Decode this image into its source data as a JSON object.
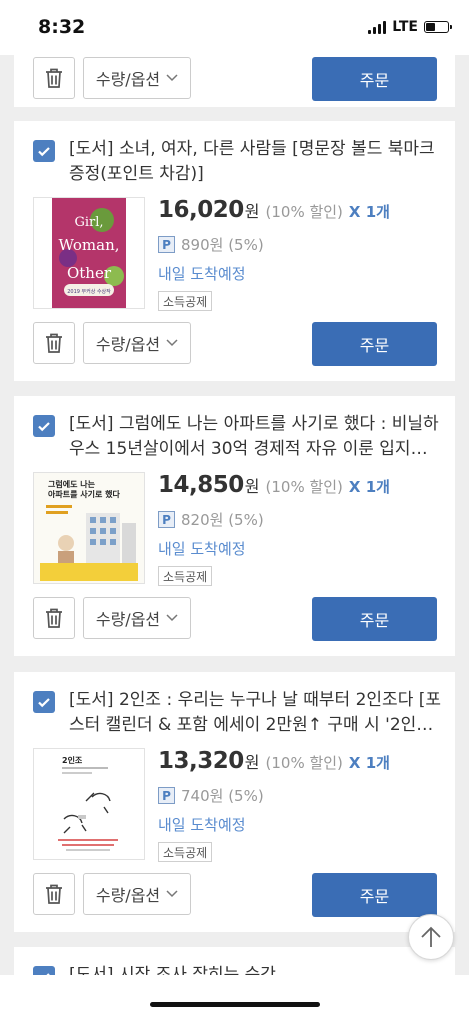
{
  "status_bar": {
    "time": "8:32",
    "network": "LTE"
  },
  "common": {
    "quantity_option_label": "수량/옵션",
    "order_label": "주문",
    "won_unit": "원"
  },
  "items": [
    {
      "title": "[도서] 소녀, 여자, 다른 사람들 [명문장 볼드 북마크 증정(포인트 차감)]",
      "price": "16,020",
      "discount": "(10% 할인)",
      "quantity": "X 1개",
      "point_badge": "P",
      "points": "890원 (5%)",
      "delivery": "내일 도착예정",
      "tag": "소득공제",
      "cover_text": [
        "Girl,",
        "Woman,",
        "Other",
        "2019 부커상 수상작"
      ]
    },
    {
      "title": "[도서] 그럼에도 나는 아파트를 사기로 했다 : 비닐하우스 15년살이에서 30억 경제적 자유 이룬 입지분석 …",
      "price": "14,850",
      "discount": "(10% 할인)",
      "quantity": "X 1개",
      "point_badge": "P",
      "points": "820원 (5%)",
      "delivery": "내일 도착예정",
      "tag": "소득공제",
      "cover_text": [
        "그럼에도 나는",
        "아파트를 사기로 했다"
      ]
    },
    {
      "title": "[도서] 2인조 : 우리는 누구나 날 때부터 2인조다 [포스터 캘린더 & 포함 에세이 2만원↑ 구매 시 '2인조 머…",
      "price": "13,320",
      "discount": "(10% 할인)",
      "quantity": "X 1개",
      "point_badge": "P",
      "points": "740원 (5%)",
      "delivery": "내일 도착예정",
      "tag": "소득공제",
      "cover_text": [
        "2인조"
      ]
    },
    {
      "title": "[도서] 시작 조사 잡히는 순간"
    }
  ],
  "colors": {
    "accent": "#3a6db5",
    "checkbox": "#4d7fc0",
    "delivery": "#5a8ccf",
    "background": "#eeeeee"
  }
}
